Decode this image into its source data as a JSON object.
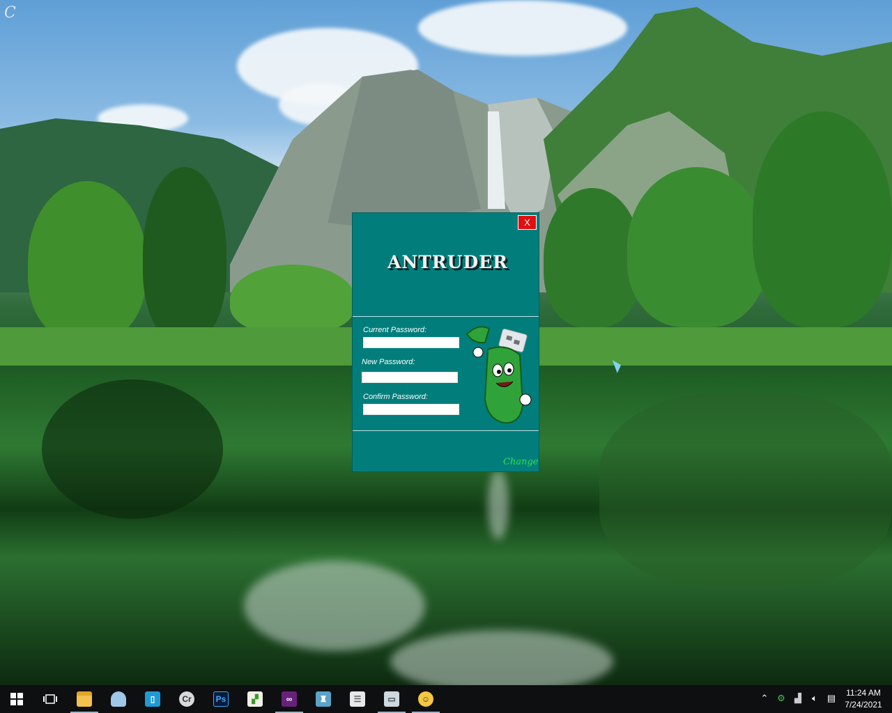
{
  "desktop": {
    "corner_glyph": "C"
  },
  "dialog": {
    "close_label": "X",
    "brand": "ANTRUDER",
    "fields": [
      {
        "label": "Current Password:",
        "value": ""
      },
      {
        "label": "New Password:",
        "value": ""
      },
      {
        "label": "Confirm Password:",
        "value": ""
      }
    ],
    "action_label": "Change"
  },
  "taskbar": {
    "pinned": [
      {
        "name": "start-icon"
      },
      {
        "name": "task-view-icon"
      },
      {
        "name": "file-explorer-icon",
        "active": true
      },
      {
        "name": "cloud-app-icon"
      },
      {
        "name": "app-bracket-icon"
      },
      {
        "name": "cr-app-icon",
        "text": "Cr"
      },
      {
        "name": "photoshop-icon",
        "text": "Ps"
      },
      {
        "name": "notepad-chart-icon"
      },
      {
        "name": "visual-studio-icon",
        "active": true
      },
      {
        "name": "shirt-app-icon"
      },
      {
        "name": "database-icon"
      },
      {
        "name": "monitor-app-icon",
        "active": true
      },
      {
        "name": "glasses-smiley-icon",
        "active": true
      }
    ],
    "clock": {
      "time": "11:24 AM",
      "date": "7/24/2021"
    }
  },
  "colors": {
    "dialog_bg": "#017e7c",
    "close_bg": "#e01010",
    "change_link": "#2fe24a",
    "taskbar_bg": "#0e0f10"
  }
}
